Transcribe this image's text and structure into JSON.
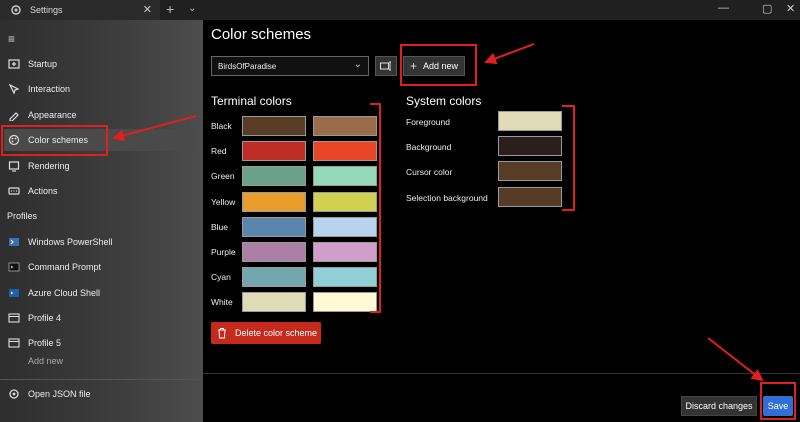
{
  "window": {
    "tab_label": "Settings",
    "tab_close": "✕",
    "new_tab": "+",
    "dropdown": "⌄",
    "minimize": "—",
    "maximize": "▢",
    "close": "✕"
  },
  "sidebar": {
    "menu_icon": "≡",
    "items": [
      {
        "label": "Startup",
        "icon": "startup-icon"
      },
      {
        "label": "Interaction",
        "icon": "interaction-icon"
      },
      {
        "label": "Appearance",
        "icon": "appearance-icon"
      },
      {
        "label": "Color schemes",
        "icon": "palette-icon",
        "selected": true
      },
      {
        "label": "Rendering",
        "icon": "rendering-icon"
      },
      {
        "label": "Actions",
        "icon": "actions-icon"
      }
    ],
    "profiles_header": "Profiles",
    "profiles": [
      {
        "label": "Windows PowerShell",
        "icon": "powershell-icon"
      },
      {
        "label": "Command Prompt",
        "icon": "cmd-icon"
      },
      {
        "label": "Azure Cloud Shell",
        "icon": "azure-icon"
      },
      {
        "label": "Profile 4",
        "icon": "terminal-icon"
      },
      {
        "label": "Profile 5",
        "icon": "terminal-icon"
      }
    ],
    "add_new": "Add new",
    "open_json": "Open JSON file"
  },
  "main": {
    "title": "Color schemes",
    "scheme_selected": "BirdsOfParadise",
    "add_new_label": "Add new",
    "terminal_colors_title": "Terminal colors",
    "terminal_colors": [
      {
        "name": "Black",
        "normal": "#573d26",
        "bright": "#9b6c4a"
      },
      {
        "name": "Red",
        "normal": "#be2d26",
        "bright": "#e84627"
      },
      {
        "name": "Green",
        "normal": "#6ba18a",
        "bright": "#95d8ba"
      },
      {
        "name": "Yellow",
        "normal": "#e99d2a",
        "bright": "#d0d150"
      },
      {
        "name": "Blue",
        "normal": "#5a86ad",
        "bright": "#b8d3ed"
      },
      {
        "name": "Purple",
        "normal": "#ac80a6",
        "bright": "#d19ecb"
      },
      {
        "name": "Cyan",
        "normal": "#74a6ad",
        "bright": "#93cfd7"
      },
      {
        "name": "White",
        "normal": "#e0dbb7",
        "bright": "#fff9d5"
      }
    ],
    "system_colors_title": "System colors",
    "system_colors": [
      {
        "name": "Foreground",
        "color": "#e0dbb7"
      },
      {
        "name": "Background",
        "color": "#2a1f1d"
      },
      {
        "name": "Cursor color",
        "color": "#573d26"
      },
      {
        "name": "Selection background",
        "color": "#563c27"
      }
    ],
    "delete_label": "Delete color scheme",
    "discard_label": "Discard changes",
    "save_label": "Save"
  },
  "colors": {
    "accent_blue": "#2f6fd6",
    "danger_red": "#c42b1c",
    "annotation_red": "#e02020"
  }
}
